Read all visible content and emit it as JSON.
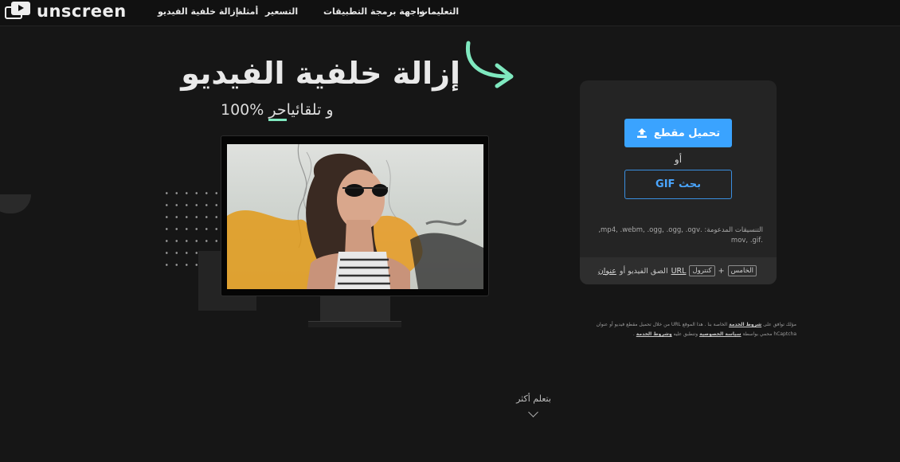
{
  "app": {
    "logo_text": "unscreen"
  },
  "nav": {
    "items": [
      {
        "label": "التعليمات"
      },
      {
        "label": "واجهة برمجة التطبيقات"
      },
      {
        "label": "التسعير"
      },
      {
        "label": "أمثلة"
      },
      {
        "label": "إزالة خلفية الفيديو"
      }
    ]
  },
  "hero": {
    "title": "إزالة خلفية الفيديو",
    "subtitle_prefix": "100% و تلقائيا",
    "subtitle_typed": "حر"
  },
  "upload": {
    "upload_button": "تحميل مقطع",
    "or": "أو",
    "gif_button": "GIF بحث",
    "formats_line1": "التنسيقات المدعومة: .mp4, .webm, .ogg, .ogg, .ogv,",
    "formats_line2": ".mov, .gif",
    "paste_key1": "الخامس",
    "paste_plus": "+",
    "paste_key2": "كنترول",
    "paste_text": "الصق الفيديو أو",
    "paste_link1": "URL",
    "paste_link2": "عنوان"
  },
  "terms": {
    "line1_a": "مؤلك توافق على ",
    "line1_b": "شروط الخدمة",
    "line1_c": " الخاصة بنا . هذا الموقع URL من خلال تحميل مقطع فيديو أو عنوان",
    "line2_a": "hCaptcha محمي بواسطة ",
    "line2_b": "سياسة الخصوصية",
    "line2_c": " وتنطبق عليه ",
    "line2_d": "وشروط الخدمة",
    "line2_e": " ."
  },
  "learn_more": "بتعلم أكثر",
  "colors": {
    "accent": "#3aa3ff",
    "mint": "#7fe8bf",
    "background": "#161616"
  }
}
